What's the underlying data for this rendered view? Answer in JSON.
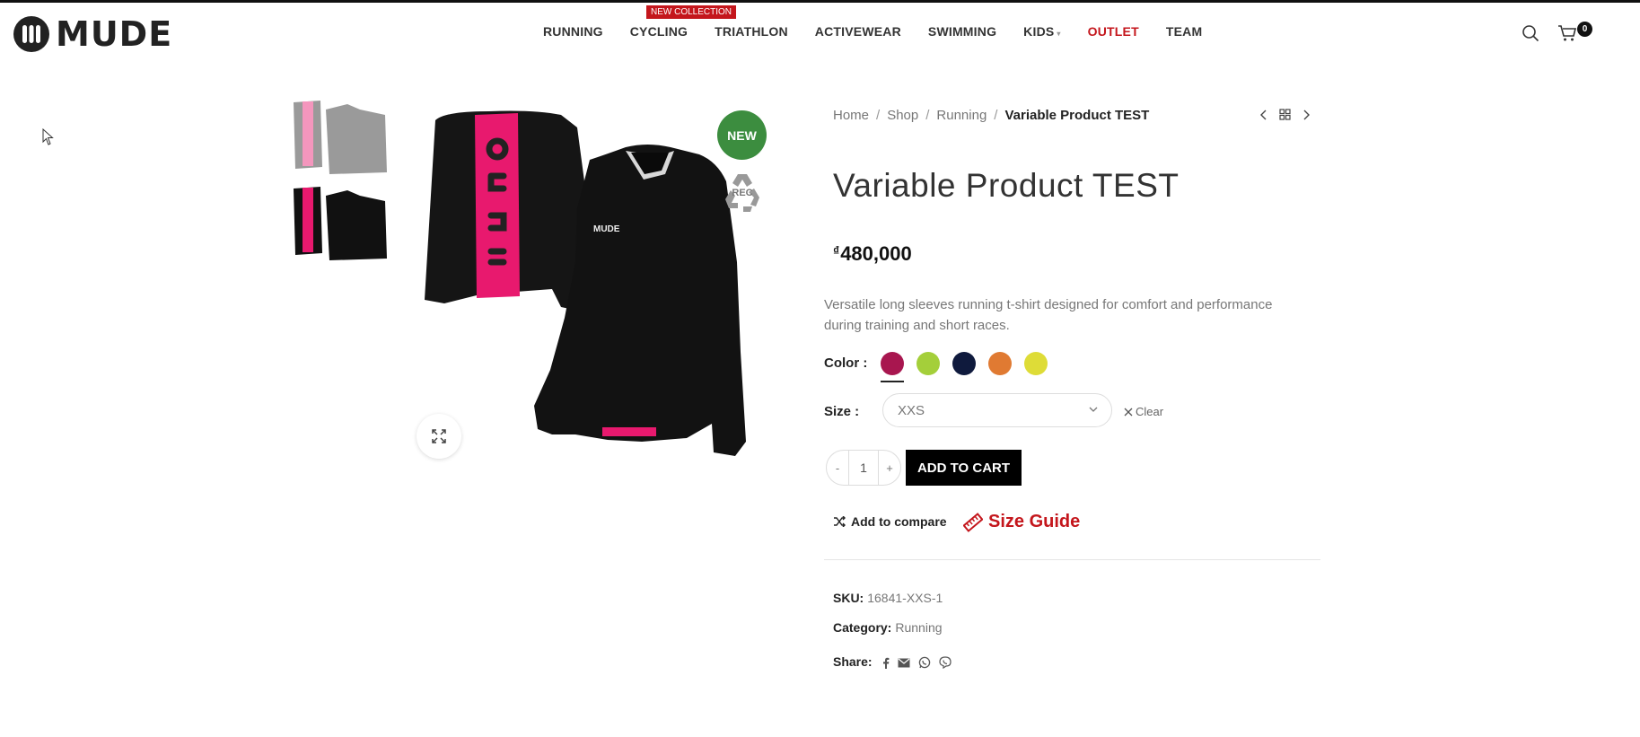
{
  "header": {
    "logo_text": "MUDE",
    "nav": [
      {
        "label": "RUNNING"
      },
      {
        "label": "CYCLING",
        "badge": "NEW COLLECTION"
      },
      {
        "label": "TRIATHLON"
      },
      {
        "label": "ACTIVEWEAR"
      },
      {
        "label": "SWIMMING"
      },
      {
        "label": "KIDS"
      },
      {
        "label": "OUTLET",
        "color": "#c4161c"
      },
      {
        "label": "TEAM"
      }
    ],
    "cart_count": "0",
    "icons": [
      "search-icon",
      "cart-icon"
    ]
  },
  "gallery": {
    "badge_new": "NEW",
    "badge_rec": "REC",
    "thumbnail_count": 2
  },
  "breadcrumb": [
    "Home",
    "Shop",
    "Running",
    "Variable Product TEST"
  ],
  "product": {
    "title": "Variable Product TEST",
    "currency": "₫",
    "price": "480,000",
    "description": "Versatile long sleeves running t-shirt designed for comfort and performance during training and short races.",
    "color_label": "Color",
    "colors": [
      "#a8164f",
      "#a4cf3a",
      "#0f1a3d",
      "#e07a32",
      "#dedc37"
    ],
    "selected_color_index": 0,
    "size_label": "Size",
    "size_value": "XXS",
    "clear_label": "Clear",
    "quantity": "1",
    "qty_minus": "-",
    "qty_plus": "+",
    "add_to_cart": "ADD TO CART",
    "compare_label": "Add to compare",
    "size_guide_label": "Size Guide",
    "sku_label": "SKU:",
    "sku": "16841-XXS-1",
    "category_label": "Category:",
    "category": "Running",
    "share_label": "Share:",
    "share_icons": [
      "facebook-icon",
      "email-icon",
      "whatsapp-icon",
      "viber-icon"
    ]
  },
  "colors": {
    "accent": "#c4161c",
    "new_badge": "#3c8d3f",
    "jersey_black": "#111111",
    "jersey_pink": "#e8196e"
  }
}
